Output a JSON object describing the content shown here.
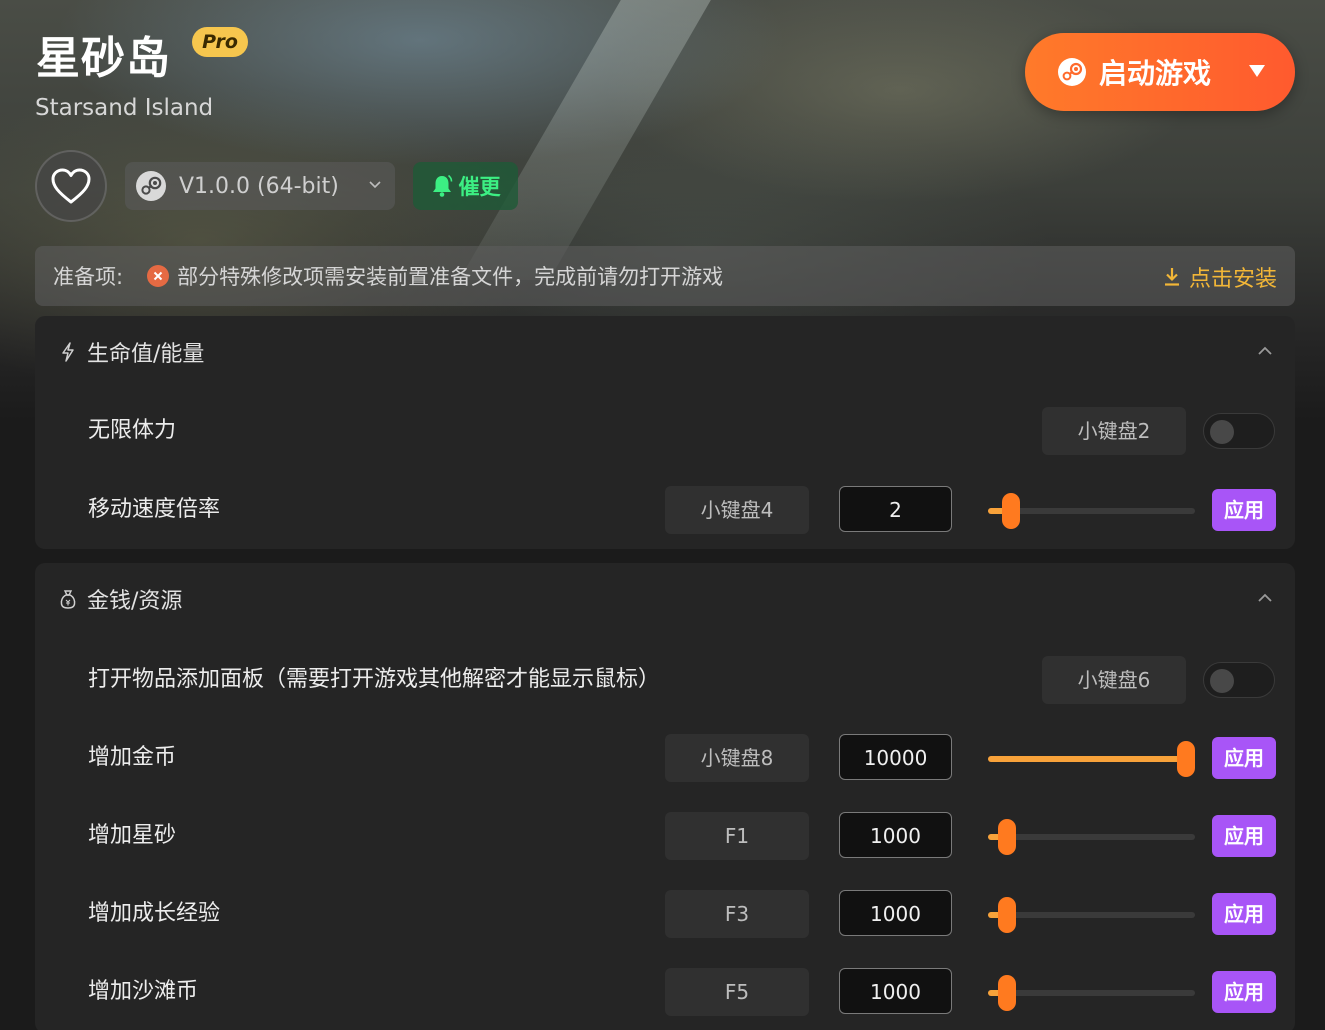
{
  "header": {
    "title": "星砂岛",
    "pro_badge": "Pro",
    "subtitle": "Starsand Island",
    "launch_label": "启动游戏",
    "version": "V1.0.0 (64-bit)",
    "urge_label": "催更"
  },
  "prep": {
    "label": "准备项:",
    "message": "部分特殊修改项需安装前置准备文件，完成前请勿打开游戏",
    "install_label": "点击安装"
  },
  "sections": [
    {
      "title": "生命值/能量",
      "icon": "lightning-icon",
      "rows": [
        {
          "label": "无限体力",
          "hotkey": "小键盘2",
          "type": "toggle",
          "enabled": false
        },
        {
          "label": "移动速度倍率",
          "hotkey": "小键盘4",
          "type": "slider",
          "value": "2",
          "fill": 0.11,
          "apply": "应用"
        }
      ]
    },
    {
      "title": "金钱/资源",
      "icon": "money-bag-icon",
      "rows": [
        {
          "label": "打开物品添加面板（需要打开游戏其他解密才能显示鼠标）",
          "hotkey": "小键盘6",
          "type": "toggle",
          "enabled": false
        },
        {
          "label": "增加金币",
          "hotkey": "小键盘8",
          "type": "slider",
          "value": "10000",
          "fill": 1.0,
          "apply": "应用"
        },
        {
          "label": "增加星砂",
          "hotkey": "F1",
          "type": "slider",
          "value": "1000",
          "fill": 0.09,
          "apply": "应用"
        },
        {
          "label": "增加成长经验",
          "hotkey": "F3",
          "type": "slider",
          "value": "1000",
          "fill": 0.09,
          "apply": "应用"
        },
        {
          "label": "增加沙滩币",
          "hotkey": "F5",
          "type": "slider",
          "value": "1000",
          "fill": 0.09,
          "apply": "应用"
        }
      ]
    }
  ],
  "colors": {
    "launch": "#ff6a2c",
    "apply": "#a855f7",
    "slider_thumb": "#ff7a1f",
    "pro_badge": "#f6c64e",
    "install": "#f2b637",
    "urge": "#3cef83"
  }
}
